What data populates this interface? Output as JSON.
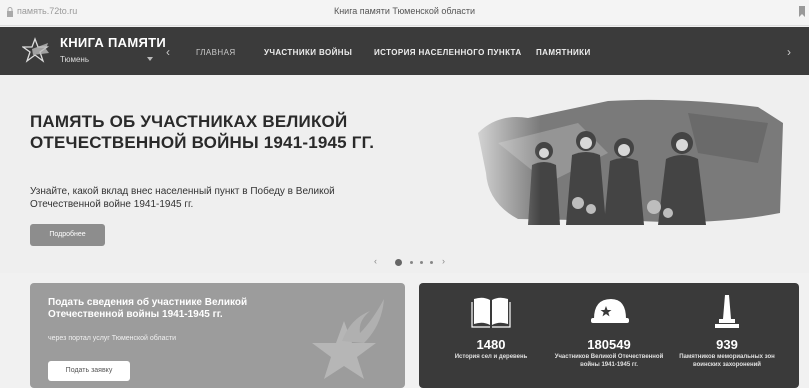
{
  "browser": {
    "url": "память.72to.ru",
    "title": "Книга памяти Тюменской области"
  },
  "nav": {
    "brand": "КНИГА ПАМЯТИ",
    "city": "Тюмень",
    "menu": [
      "ГЛАВНАЯ",
      "УЧАСТНИКИ ВОЙНЫ",
      "ИСТОРИЯ НАСЕЛЕННОГО ПУНКТА",
      "ПАМЯТНИКИ"
    ]
  },
  "hero": {
    "heading": "ПАМЯТЬ ОБ УЧАСТНИКАХ ВЕЛИКОЙ ОТЕЧЕСТВЕННОЙ ВОЙНЫ 1941-1945 ГГ.",
    "lead": "Узнайте, какой вклад внес населенный пункт в Победу в Великой Отечественной войне 1941-1945 гг.",
    "button": "Подробнее"
  },
  "carousel": {
    "slides": 4,
    "active": 1
  },
  "submit_card": {
    "title": "Подать сведения об участнике Великой Отечественной войны 1941-1945 гг.",
    "subtitle": "через портал услуг Тюменской области",
    "button": "Подать заявку"
  },
  "stats": [
    {
      "icon": "book-icon",
      "value": "1480",
      "label": "История сел и деревень"
    },
    {
      "icon": "helmet-icon",
      "value": "180549",
      "label": "Участников Великой Отечественной войны 1941-1945 гг."
    },
    {
      "icon": "obelisk-icon",
      "value": "939",
      "label": "Памятников мемориальных зон воинских захоронений"
    }
  ],
  "colors": {
    "nav_bg": "#3b3b3b",
    "card_dark": "#3a3a3a",
    "card_grey": "#9c9c9c"
  }
}
